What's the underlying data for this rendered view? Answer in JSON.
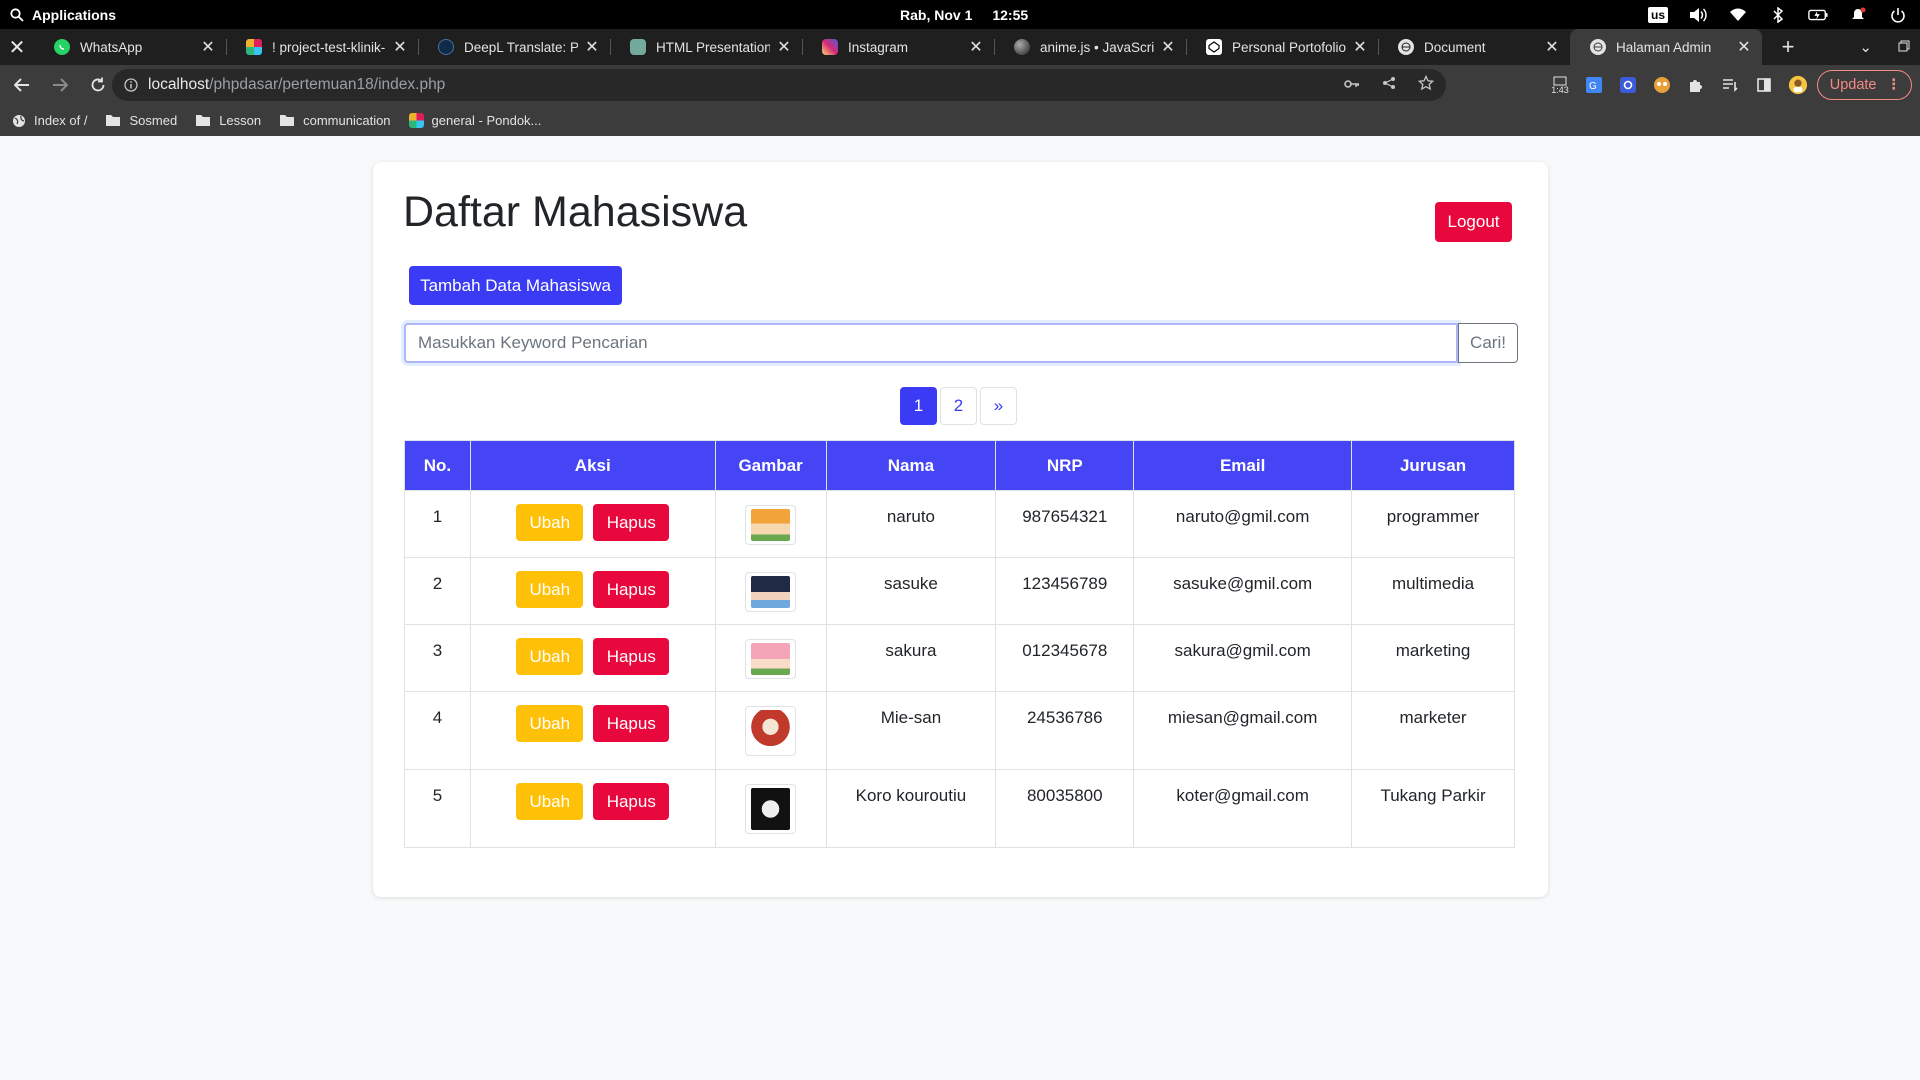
{
  "system": {
    "apps_label": "Applications",
    "date": "Rab, Nov  1",
    "time": "12:55",
    "keyboard_layout": "us"
  },
  "tabs": [
    {
      "title": "WhatsApp",
      "favicon_color": "#25d366"
    },
    {
      "title": "! project-test-klinik-b",
      "favicon_color": "#e01e5a"
    },
    {
      "title": "DeepL Translate: Pen",
      "favicon_color": "#0f2b46"
    },
    {
      "title": "HTML Presentation C",
      "favicon_color": "#74aa9c"
    },
    {
      "title": "Instagram",
      "favicon_color": "#d62976"
    },
    {
      "title": "anime.js • JavaScript",
      "favicon_color": "#555555"
    },
    {
      "title": "Personal Portofolio",
      "favicon_color": "#ffffff"
    },
    {
      "title": "Document",
      "favicon_color": "#ffffff"
    },
    {
      "title": "Halaman Admin",
      "favicon_color": "#ffffff",
      "active": true
    }
  ],
  "toolbar": {
    "url_host": "localhost",
    "url_path": "/phpdasar/pertemuan18/index.php",
    "cast_time": "1:43",
    "update_label": "Update"
  },
  "bookmarks": [
    {
      "label": "Index of /",
      "icon": "globe-icon"
    },
    {
      "label": "Sosmed",
      "icon": "folder-icon"
    },
    {
      "label": "Lesson",
      "icon": "folder-icon"
    },
    {
      "label": "communication",
      "icon": "folder-icon"
    },
    {
      "label": "general - Pondok...",
      "icon": "slack-icon"
    }
  ],
  "page": {
    "title": "Daftar Mahasiswa",
    "logout_label": "Logout",
    "add_label": "Tambah Data Mahasiswa",
    "search_placeholder": "Masukkan Keyword Pencarian",
    "search_button": "Cari!",
    "pagination": [
      "1",
      "2",
      "»"
    ],
    "current_page": "1"
  },
  "table": {
    "headers": [
      "No.",
      "Aksi",
      "Gambar",
      "Nama",
      "NRP",
      "Email",
      "Jurusan"
    ],
    "edit_label": "Ubah",
    "delete_label": "Hapus",
    "rows": [
      {
        "no": "1",
        "nama": "naruto",
        "nrp": "987654321",
        "email": "naruto@gmil.com",
        "jurusan": "programmer",
        "thumb_colors": [
          "#f2a33a",
          "#6aa84f"
        ]
      },
      {
        "no": "2",
        "nama": "sasuke",
        "nrp": "123456789",
        "email": "sasuke@gmil.com",
        "jurusan": "multimedia",
        "thumb_colors": [
          "#1f2a44",
          "#6fa8dc"
        ]
      },
      {
        "no": "3",
        "nama": "sakura",
        "nrp": "012345678",
        "email": "sakura@gmil.com",
        "jurusan": "marketing",
        "thumb_colors": [
          "#f4a6b8",
          "#6aa84f"
        ]
      },
      {
        "no": "4",
        "nama": "Mie-san",
        "nrp": "24536786",
        "email": "miesan@gmail.com",
        "jurusan": "marketer",
        "thumb_colors": [
          "#c0392b",
          "#f5e6d3"
        ]
      },
      {
        "no": "5",
        "nama": "Koro kouroutiu",
        "nrp": "80035800",
        "email": "koter@gmail.com",
        "jurusan": "Tukang Parkir",
        "thumb_colors": [
          "#111111",
          "#eeeeee"
        ]
      }
    ]
  },
  "colors": {
    "primary": "#3b3bf5",
    "header": "#4545f5",
    "danger": "#e8083e",
    "warning": "#ffc107"
  }
}
